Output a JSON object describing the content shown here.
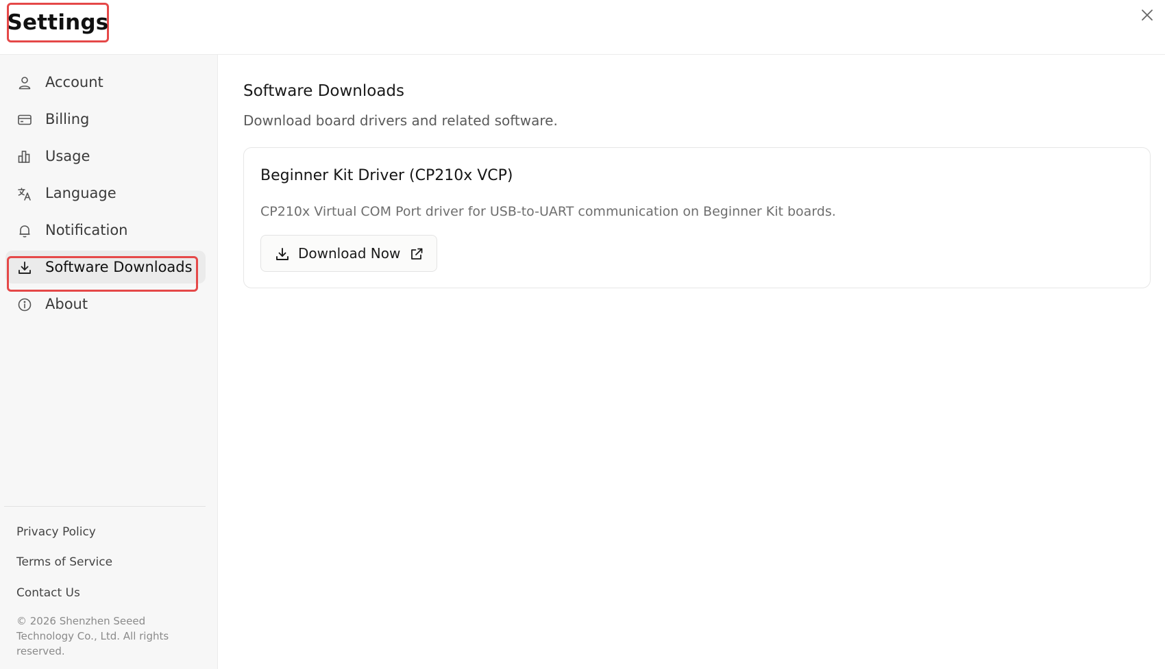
{
  "header": {
    "title": "Settings"
  },
  "sidebar": {
    "items": [
      {
        "label": "Account",
        "icon": "user-icon"
      },
      {
        "label": "Billing",
        "icon": "credit-card-icon"
      },
      {
        "label": "Usage",
        "icon": "bar-chart-icon"
      },
      {
        "label": "Language",
        "icon": "translate-icon"
      },
      {
        "label": "Notification",
        "icon": "bell-icon"
      },
      {
        "label": "Software Downloads",
        "icon": "download-icon",
        "active": true
      },
      {
        "label": "About",
        "icon": "info-icon"
      }
    ],
    "footer_links": [
      "Privacy Policy",
      "Terms of Service",
      "Contact Us"
    ],
    "copyright": "© 2026 Shenzhen Seeed Technology Co., Ltd. All rights reserved."
  },
  "main": {
    "title": "Software Downloads",
    "subtitle": "Download board drivers and related software.",
    "card": {
      "title": "Beginner Kit Driver (CP210x VCP)",
      "description": "CP210x Virtual COM Port driver for USB-to-UART communication on Beginner Kit boards.",
      "button_label": "Download Now",
      "button_icon": "download-icon",
      "button_trailing_icon": "external-link-icon"
    }
  },
  "colors": {
    "highlight": "#e54848",
    "sidebar_bg": "#f7f7f7",
    "active_bg": "#ebebeb"
  }
}
